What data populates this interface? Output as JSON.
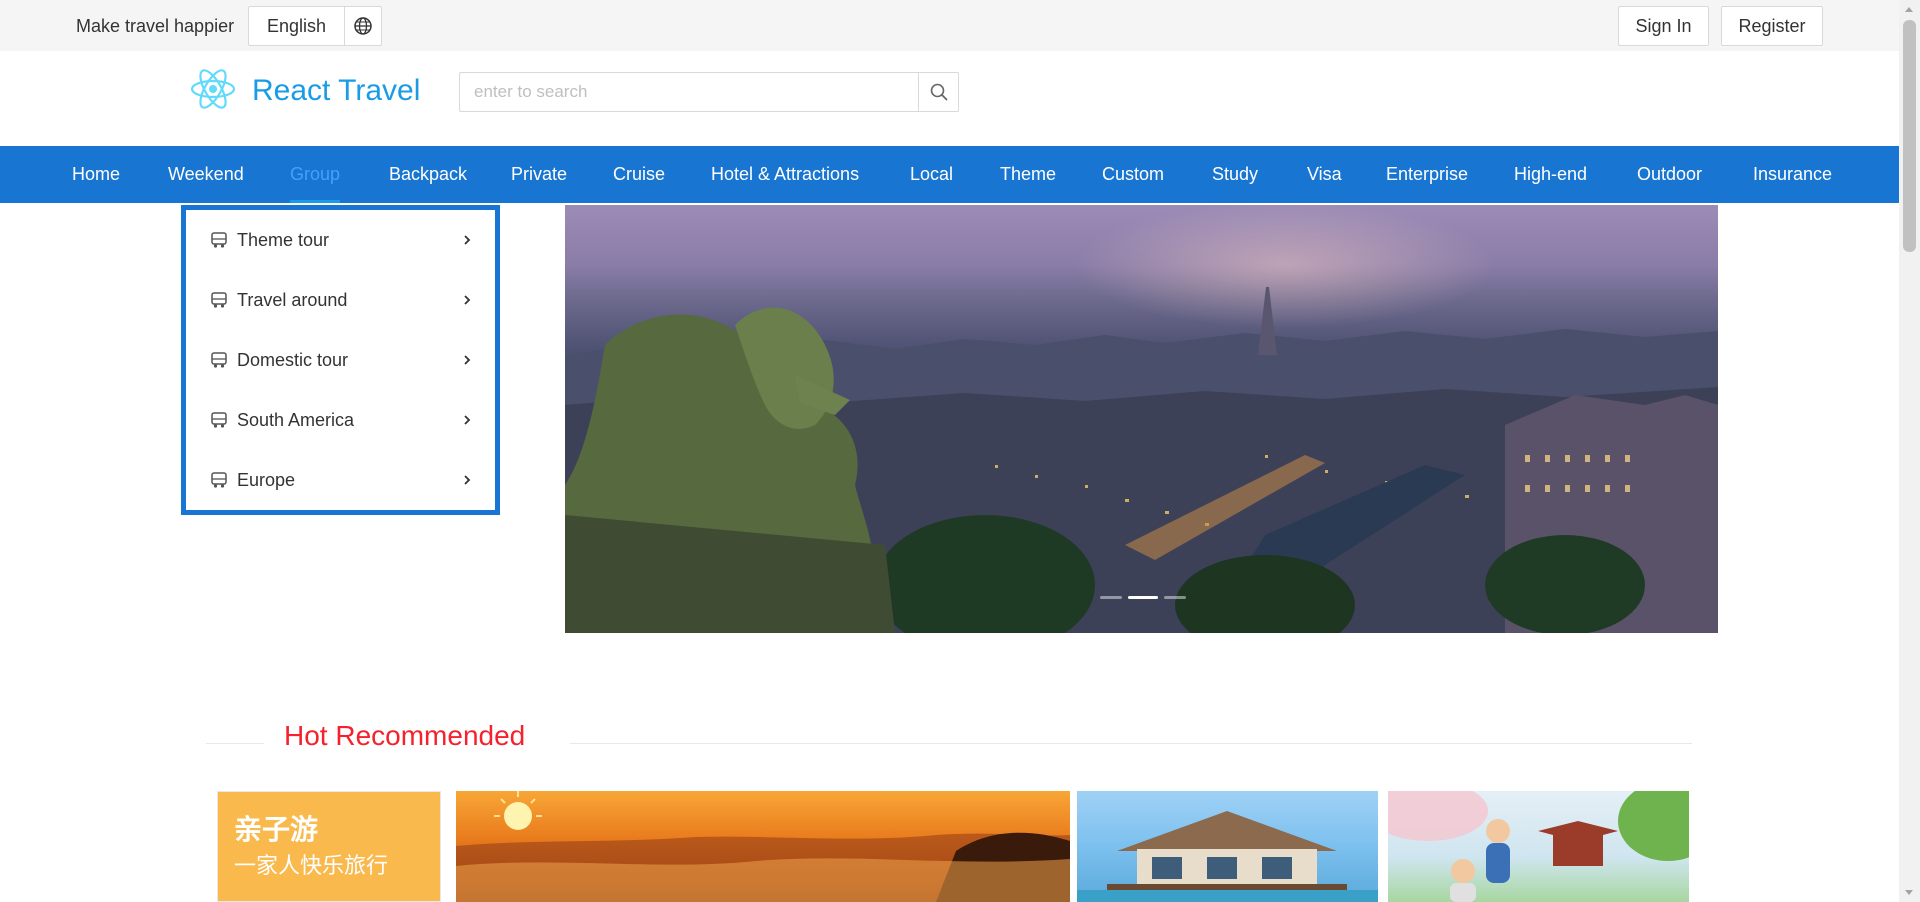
{
  "topbar": {
    "slogan": "Make travel happier",
    "language": "English",
    "language_icon": "globe-icon",
    "sign_in": "Sign In",
    "register": "Register"
  },
  "header": {
    "logo_icon": "react-atom-icon",
    "title": "React Travel",
    "search_placeholder": "enter to search",
    "search_value": "",
    "search_icon": "search-icon"
  },
  "nav": {
    "active": "Group",
    "items": [
      "Home",
      "Weekend",
      "Group",
      "Backpack",
      "Private",
      "Cruise",
      "Hotel & Attractions",
      "Local",
      "Theme",
      "Custom",
      "Study",
      "Visa",
      "Enterprise",
      "High-end",
      "Outdoor",
      "Insurance"
    ]
  },
  "side_menu": {
    "item_icon": "bus-icon",
    "items": [
      "Theme tour",
      "Travel around",
      "Domestic tour",
      "South America",
      "Europe"
    ]
  },
  "banner": {
    "slides": 3,
    "active_slide": 2
  },
  "hot": {
    "title": "Hot Recommended",
    "card1_line1": "亲子游",
    "card1_line2": "一家人快乐旅行"
  },
  "colors": {
    "nav_bg": "#1876d2",
    "brand": "#1a9be6",
    "hot_title": "#f5222d"
  }
}
